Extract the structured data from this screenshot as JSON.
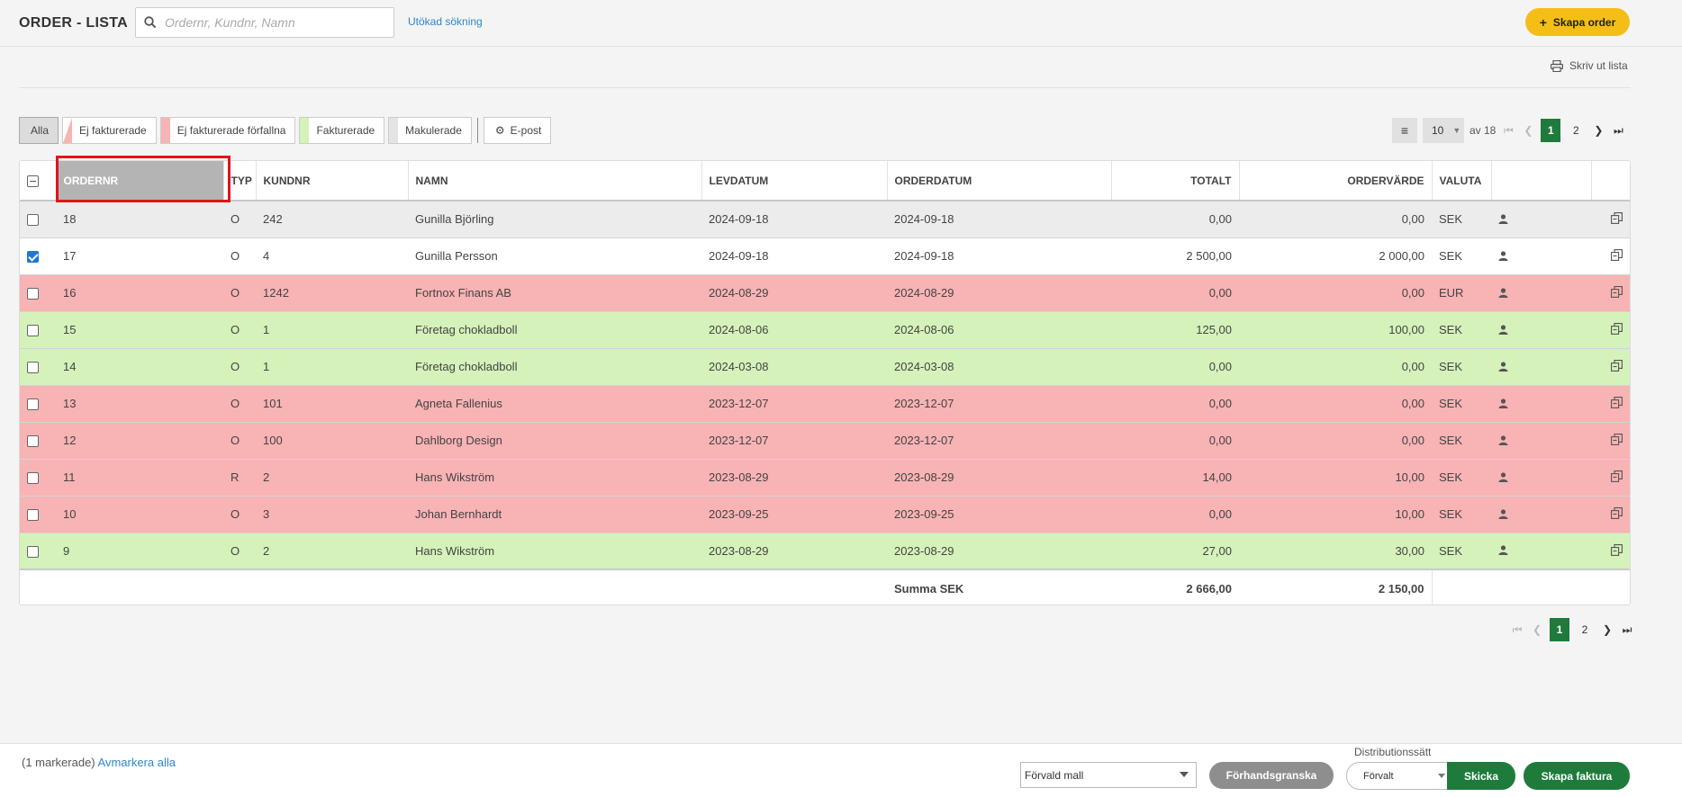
{
  "header": {
    "title": "ORDER - LISTA",
    "search_placeholder": "Ordernr, Kundnr, Namn",
    "advanced_search": "Utökad sökning",
    "create_order": "Skapa order",
    "print_list": "Skriv ut lista"
  },
  "filters": {
    "all": "Alla",
    "not_invoiced": "Ej fakturerade",
    "not_invoiced_overdue": "Ej fakturerade förfallna",
    "invoiced": "Fakturerade",
    "cancelled": "Makulerade",
    "email": "E-post",
    "colors": {
      "not_invoiced": "#f8b3b4",
      "not_invoiced_overdue": "#f8b3b4",
      "invoiced": "#d4f2b9",
      "cancelled": "#e4e4e4"
    }
  },
  "pagination": {
    "page_size": "10",
    "of_label": "av 18",
    "pages": [
      "1",
      "2"
    ],
    "current": "1"
  },
  "table": {
    "columns": {
      "ordernr": "ORDERNR",
      "typ": "TYP",
      "kundnr": "KUNDNR",
      "namn": "NAMN",
      "levdatum": "LEVDATUM",
      "orderdatum": "ORDERDATUM",
      "totalt": "TOTALT",
      "ordervarde": "ORDERVÄRDE",
      "valuta": "VALUTA"
    },
    "rows": [
      {
        "ordernr": "18",
        "typ": "O",
        "kundnr": "242",
        "namn": "Gunilla Björling",
        "levdatum": "2024-09-18",
        "orderdatum": "2024-09-18",
        "totalt": "0,00",
        "ordervarde": "0,00",
        "valuta": "SEK",
        "status": "gray",
        "checked": false
      },
      {
        "ordernr": "17",
        "typ": "O",
        "kundnr": "4",
        "namn": "Gunilla Persson",
        "levdatum": "2024-09-18",
        "orderdatum": "2024-09-18",
        "totalt": "2 500,00",
        "ordervarde": "2 000,00",
        "valuta": "SEK",
        "status": "white",
        "checked": true
      },
      {
        "ordernr": "16",
        "typ": "O",
        "kundnr": "1242",
        "namn": "Fortnox Finans AB",
        "levdatum": "2024-08-29",
        "orderdatum": "2024-08-29",
        "totalt": "0,00",
        "ordervarde": "0,00",
        "valuta": "EUR",
        "status": "red",
        "checked": false
      },
      {
        "ordernr": "15",
        "typ": "O",
        "kundnr": "1",
        "namn": "Företag chokladboll",
        "levdatum": "2024-08-06",
        "orderdatum": "2024-08-06",
        "totalt": "125,00",
        "ordervarde": "100,00",
        "valuta": "SEK",
        "status": "green",
        "checked": false
      },
      {
        "ordernr": "14",
        "typ": "O",
        "kundnr": "1",
        "namn": "Företag chokladboll",
        "levdatum": "2024-03-08",
        "orderdatum": "2024-03-08",
        "totalt": "0,00",
        "ordervarde": "0,00",
        "valuta": "SEK",
        "status": "green",
        "checked": false
      },
      {
        "ordernr": "13",
        "typ": "O",
        "kundnr": "101",
        "namn": "Agneta Fallenius",
        "levdatum": "2023-12-07",
        "orderdatum": "2023-12-07",
        "totalt": "0,00",
        "ordervarde": "0,00",
        "valuta": "SEK",
        "status": "red",
        "checked": false
      },
      {
        "ordernr": "12",
        "typ": "O",
        "kundnr": "100",
        "namn": "Dahlborg Design",
        "levdatum": "2023-12-07",
        "orderdatum": "2023-12-07",
        "totalt": "0,00",
        "ordervarde": "0,00",
        "valuta": "SEK",
        "status": "red",
        "checked": false
      },
      {
        "ordernr": "11",
        "typ": "R",
        "kundnr": "2",
        "namn": "Hans Wikström",
        "levdatum": "2023-08-29",
        "orderdatum": "2023-08-29",
        "totalt": "14,00",
        "ordervarde": "10,00",
        "valuta": "SEK",
        "status": "red",
        "checked": false
      },
      {
        "ordernr": "10",
        "typ": "O",
        "kundnr": "3",
        "namn": "Johan Bernhardt",
        "levdatum": "2023-09-25",
        "orderdatum": "2023-09-25",
        "totalt": "0,00",
        "ordervarde": "10,00",
        "valuta": "SEK",
        "status": "red",
        "checked": false
      },
      {
        "ordernr": "9",
        "typ": "O",
        "kundnr": "2",
        "namn": "Hans Wikström",
        "levdatum": "2023-08-29",
        "orderdatum": "2023-08-29",
        "totalt": "27,00",
        "ordervarde": "30,00",
        "valuta": "SEK",
        "status": "green",
        "checked": false
      }
    ],
    "summary": {
      "label": "Summa SEK",
      "totalt": "2 666,00",
      "ordervarde": "2 150,00"
    }
  },
  "bottom": {
    "selected_count": "(1 markerade)",
    "deselect_all": "Avmarkera alla",
    "template": "Förvald mall",
    "preview": "Förhandsgranska",
    "distribution_label": "Distributionssätt",
    "distribution_value": "Förvalt",
    "send": "Skicka",
    "create_invoice": "Skapa faktura"
  }
}
